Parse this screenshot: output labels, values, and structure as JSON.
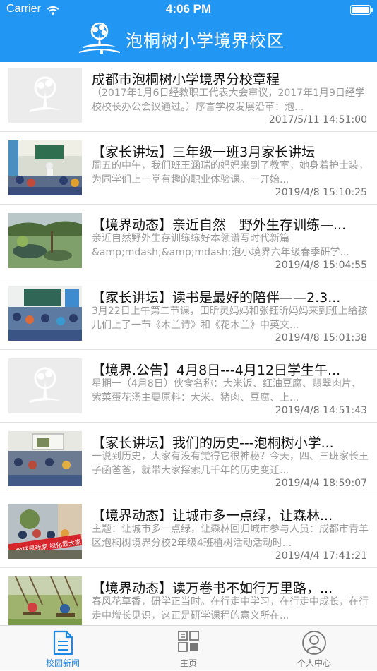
{
  "status_bar": {
    "carrier": "Carrier",
    "time": "4:06 PM"
  },
  "header": {
    "title": "泡桐树小学境界校区"
  },
  "news": [
    {
      "title": "成都市泡桐树小学境界分校章程",
      "summary": "（2017年1月6日经教职工代表大会审议，2017年1月9日经学校校长办公会议通过。）序言学校发展沿革：泡...",
      "date": "2017/5/11 14:51:00",
      "thumbnail": "placeholder-logo"
    },
    {
      "title": "【家长讲坛】三年级一班3月家长讲坛",
      "summary": "周五的中午，我们班王涵瑞的妈妈来到了教室，她身着护士装，为同学们上一堂有趣的职业体验课。一开始...",
      "date": "2019/4/8 15:10:25",
      "thumbnail": "classroom-photo"
    },
    {
      "title": "【境界动态】亲近自然　野外生存训练—...",
      "summary": "亲近自然野外生存训练练好本领谱写时代新篇&amp;mdash;&amp;mdash;泡小境界六年级春季研学...",
      "date": "2019/4/8 15:04:55",
      "thumbnail": "nature-photo"
    },
    {
      "title": "【家长讲坛】读书是最好的陪伴——2.3...",
      "summary": "3月22日上午第二节课，田昕灵妈妈和张钰昕妈妈来到班上给孩儿们上了一节《木兰诗》和《花木兰》中英文...",
      "date": "2019/4/8 15:01:38",
      "thumbnail": "classroom-photo"
    },
    {
      "title": "【境界.公告】4月8日---4月12日学生午...",
      "summary": "星期一（4月8日）伙食名称：大米饭、红油豆腐、翡翠肉片、紫菜蛋花汤主要原料：大米、猪肉、豆腐、上...",
      "date": "2019/4/8 14:51:43",
      "thumbnail": "placeholder-logo"
    },
    {
      "title": "【家长讲坛】我们的历史---泡桐树小学...",
      "summary": "一说到历史，大家有没有觉得它很神秘？今天，四、三班家长王子函爸爸，就带大家探索几千年的历史变迁...",
      "date": "2019/4/4 18:59:07",
      "thumbnail": "classroom-photo"
    },
    {
      "title": "【境界动态】让城市多一点绿，让森林...",
      "summary": "主题：让城市多一点绿，让森林回归城市参与人员：成都市青羊区泡桐树境界分校2年级4班植树活动活动时...",
      "date": "2019/4/4 17:41:21",
      "thumbnail": "tree-planting-photo",
      "banner_text": "地球是我家 绿化靠大家"
    },
    {
      "title": "【境界动态】读万卷书不如行万里路，...",
      "summary": "春风花草香，研学正当时。在行走中学习，在行走中成长，在行走中增长见识，这正是研学课程的意义所在...",
      "date": "",
      "thumbnail": "swing-photo"
    }
  ],
  "tab_bar": {
    "tabs": [
      {
        "label": "校园新闻",
        "icon": "document-icon",
        "active": true
      },
      {
        "label": "主页",
        "icon": "grid-icon",
        "active": false
      },
      {
        "label": "个人中心",
        "icon": "user-icon",
        "active": false
      }
    ]
  },
  "colors": {
    "accent": "#2196f3",
    "tab_active": "#1e88e5"
  }
}
